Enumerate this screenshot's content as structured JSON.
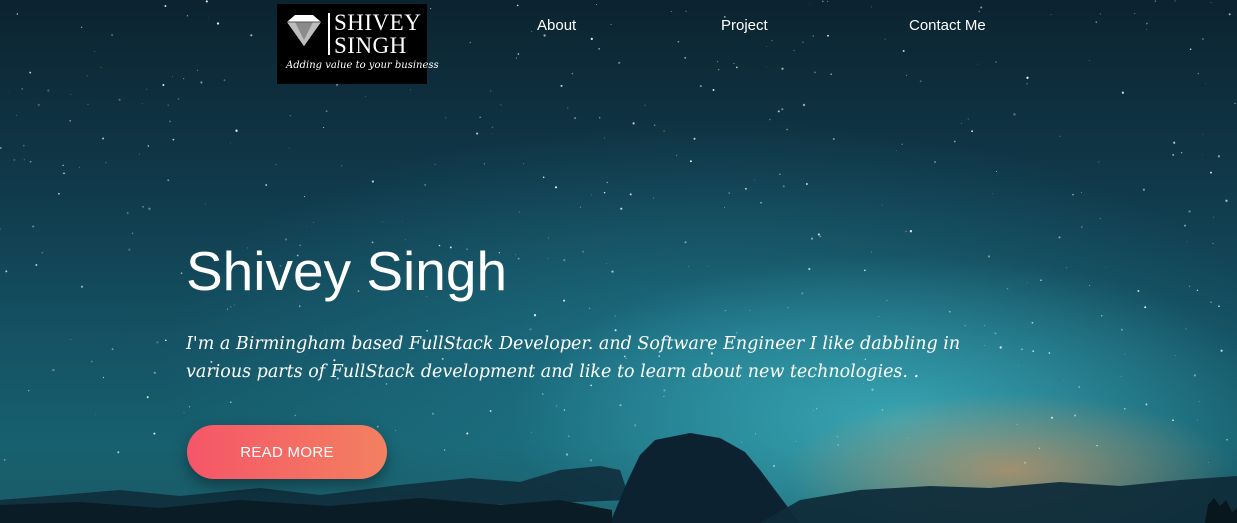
{
  "nav": {
    "logo": {
      "name_line1": "SHIVEY",
      "name_line2": "SINGH",
      "tagline": "Adding value to your business"
    },
    "links": [
      {
        "label": "About"
      },
      {
        "label": "Project"
      },
      {
        "label": "Contact Me"
      }
    ]
  },
  "hero": {
    "title": "Shivey Singh",
    "description": "I'm a Birmingham based FullStack Developer. and Software Engineer I like dabbling in various parts of FullStack development and like to learn about new technologies. .",
    "button_label": "READ MORE"
  },
  "colors": {
    "button_gradient_start": "#f55668",
    "button_gradient_end": "#f38060",
    "sky_dark": "#0c2330",
    "sky_teal": "#17606f"
  },
  "icons": {
    "logo_mark": "diamond-icon"
  }
}
